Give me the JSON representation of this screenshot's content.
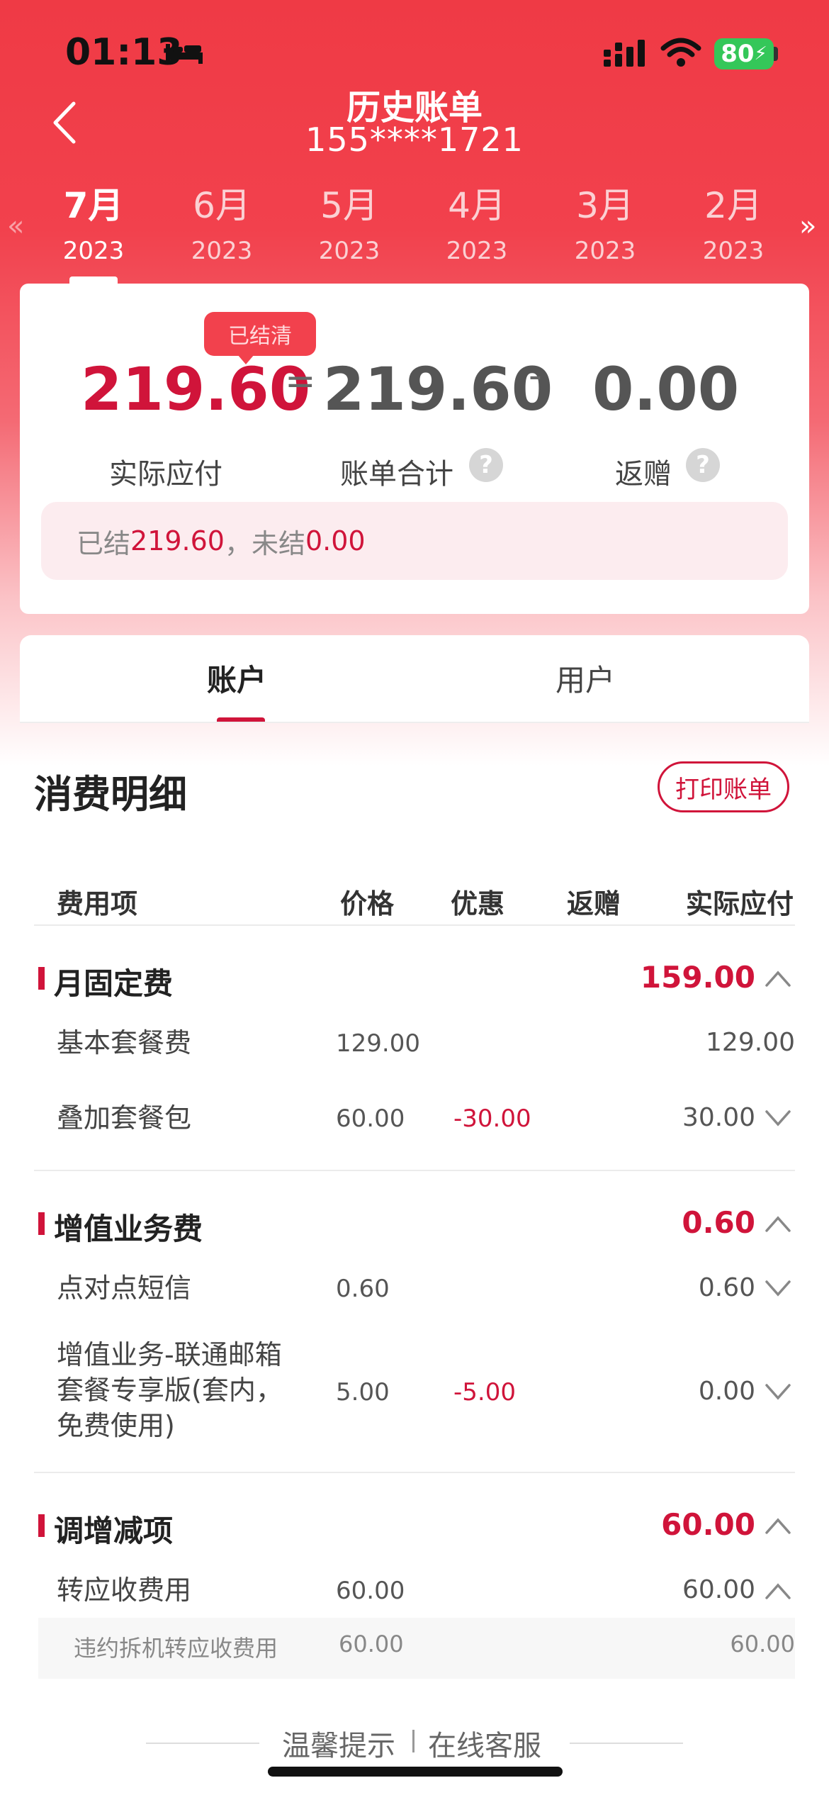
{
  "status_bar": {
    "time": "01:13",
    "battery": "80",
    "icons": [
      "bed-icon",
      "signal-icon",
      "wifi-icon",
      "battery-icon"
    ]
  },
  "header": {
    "title": "历史账单",
    "subtitle": "155****1721",
    "back_icon": "chevron-left-icon"
  },
  "months": [
    {
      "month": "7月",
      "year": "2023",
      "active": true
    },
    {
      "month": "6月",
      "year": "2023"
    },
    {
      "month": "5月",
      "year": "2023"
    },
    {
      "month": "4月",
      "year": "2023"
    },
    {
      "month": "3月",
      "year": "2023"
    },
    {
      "month": "2月",
      "year": "2023"
    }
  ],
  "month_nav": {
    "prev": "«",
    "next": "»"
  },
  "summary": {
    "badge": "已结清",
    "actual_amount": "219.60",
    "equals": "=",
    "total_amount": "219.60",
    "minus": "-",
    "gift_amount": "0.00",
    "actual_label": "实际应付",
    "total_label": "账单合计",
    "gift_label": "返赠",
    "help": "?",
    "settled_prefix": "已结",
    "settled_value": "219.60",
    "unsettled_prefix": "，未结",
    "unsettled_value": "0.00"
  },
  "tabs": {
    "account": "账户",
    "user": "用户"
  },
  "detail": {
    "title": "消费明细",
    "print_button": "打印账单",
    "columns": {
      "item": "费用项",
      "price": "价格",
      "discount": "优惠",
      "gift": "返赠",
      "actual": "实际应付"
    },
    "categories": [
      {
        "title": "月固定费",
        "amount": "159.00",
        "items": [
          {
            "name": "基本套餐费",
            "price": "129.00",
            "discount": "",
            "actual": "129.00"
          },
          {
            "name": "叠加套餐包",
            "price": "60.00",
            "discount": "-30.00",
            "actual": "30.00"
          }
        ]
      },
      {
        "title": "增值业务费",
        "amount": "0.60",
        "items": [
          {
            "name": "点对点短信",
            "price": "0.60",
            "discount": "",
            "actual": "0.60"
          },
          {
            "name_lines": [
              "增值业务-联通邮箱",
              "套餐专享版(套内，",
              "免费使用)"
            ],
            "price": "5.00",
            "discount": "-5.00",
            "actual": "0.00"
          }
        ]
      },
      {
        "title": "调增减项",
        "amount": "60.00",
        "items": [
          {
            "name": "转应收费用",
            "price": "60.00",
            "discount": "",
            "actual": "60.00",
            "sub_items": [
              {
                "name": "违约拆机转应收费用",
                "price": "60.00",
                "actual": "60.00"
              }
            ]
          }
        ]
      }
    ]
  },
  "footer": {
    "tips": "温馨提示",
    "service": "在线客服"
  },
  "colors": {
    "brand_red": "#ef3a45",
    "accent": "#d0143a"
  }
}
